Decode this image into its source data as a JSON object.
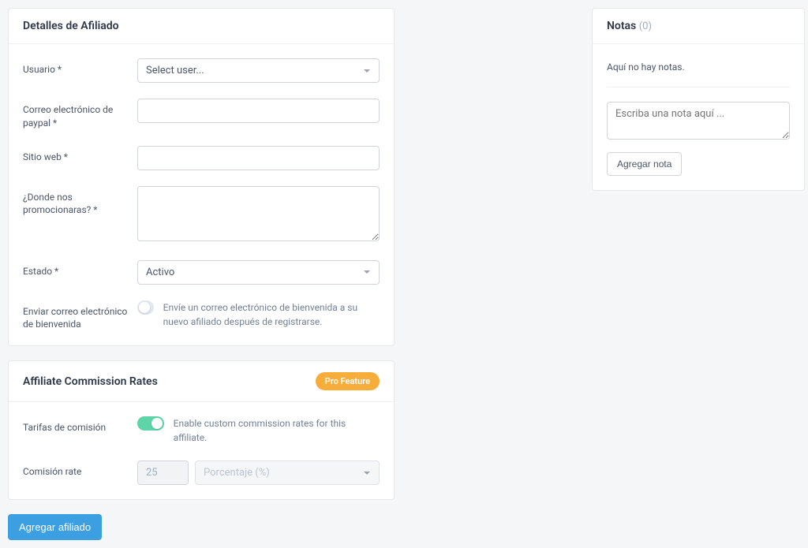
{
  "details": {
    "title": "Detalles de Afiliado",
    "labels": {
      "user": "Usuario *",
      "paypal": "Correo electrónico de paypal *",
      "website": "Sitio web *",
      "promote": "¿Donde nos promocionaras? *",
      "status": "Estado *",
      "welcome": "Enviar correo electrónico de bienvenida"
    },
    "user_select_placeholder": "Select user...",
    "status_value": "Activo",
    "welcome_desc": "Envíe un correo electrónico de bienvenida a su nuevo afiliado después de registrarse."
  },
  "rates": {
    "title": "Affiliate Commission Rates",
    "badge": "Pro Feature",
    "labels": {
      "rates": "Tarifas de comisión",
      "rate": "Comisión rate"
    },
    "enable_desc": "Enable custom commission rates for this affiliate.",
    "rate_value": "25",
    "rate_type": "Porcentaje (%)"
  },
  "submit": "Agregar afiliado",
  "notes": {
    "title": "Notas",
    "count": "(0)",
    "empty": "Aquí no hay notas.",
    "placeholder": "Escriba una nota aquí ...",
    "button": "Agregar nota"
  }
}
